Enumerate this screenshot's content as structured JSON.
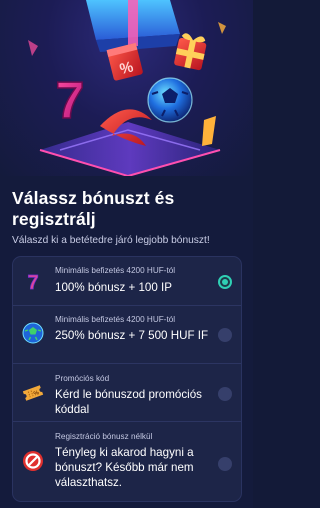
{
  "header": {
    "title": "Válassz bónuszt és regisztrálj",
    "subtitle": "Válaszd ki a betétedre járó legjobb bónuszt!"
  },
  "hero": {
    "icons": [
      "percent-gift-icon",
      "gift-box-icon",
      "seven-icon",
      "soccer-ball-icon",
      "lightning-icon"
    ]
  },
  "options": [
    {
      "icon": "seven-icon",
      "small": "Minimális befizetés 4200 HUF-tól",
      "main": "100% bónusz + 100 IP",
      "selected": true
    },
    {
      "icon": "soccer-ball-icon",
      "small": "Minimális befizetés 4200 HUF-tól",
      "main": "250% bónusz + 7 500 HUF IF",
      "selected": false
    },
    {
      "icon": "ticket-icon",
      "small": "Promóciós kód",
      "main": "Kérd le bónuszod promóciós kóddal",
      "selected": false
    },
    {
      "icon": "no-bonus-icon",
      "small": "Regisztráció bónusz nélkül",
      "main": "Tényleg ki akarod hagyni a bónuszt? Később már nem választhatsz.",
      "selected": false
    }
  ],
  "colors": {
    "background": "#141b3c",
    "card": "#1d2548",
    "accent": "#2fd0b4",
    "radio": "#363f6b"
  }
}
